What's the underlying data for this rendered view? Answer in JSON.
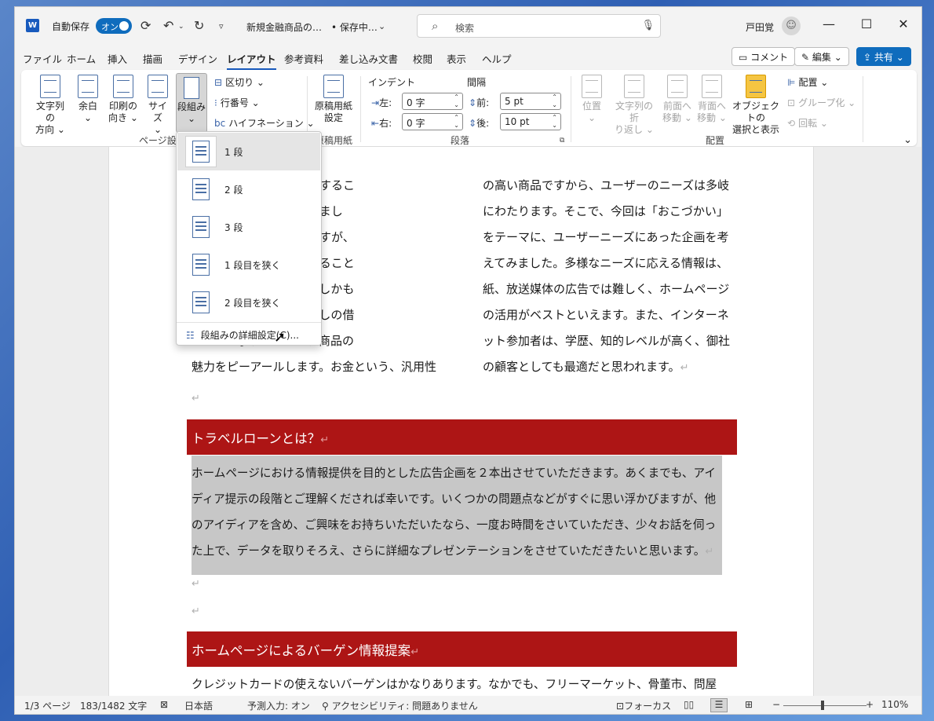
{
  "app": {
    "autosave_label": "自動保存",
    "autosave_state": "オン",
    "doc_title": "新規金融商品の…",
    "doc_status": "• 保存中…",
    "search_placeholder": "検索",
    "user_name": "戸田覚"
  },
  "tabs": [
    "ファイル",
    "ホーム",
    "挿入",
    "描画",
    "デザイン",
    "レイアウト",
    "参考資料",
    "差し込み文書",
    "校閲",
    "表示",
    "ヘルプ"
  ],
  "active_tab": "レイアウト",
  "top_buttons": {
    "comment": "コメント",
    "edit": "編集",
    "share": "共有"
  },
  "ribbon": {
    "page_setup": {
      "group_label": "ページ設定",
      "text_direction": [
        "文字列の",
        "方向"
      ],
      "margins": "余白",
      "orientation": [
        "印刷の",
        "向き"
      ],
      "size": "サイズ",
      "columns": "段組み",
      "breaks": "区切り",
      "line_numbers": "行番号",
      "hyphenation": "ハイフネーション"
    },
    "manuscript": {
      "group_label": "原稿用紙",
      "button": [
        "原稿用紙",
        "設定"
      ]
    },
    "paragraph": {
      "group_label": "段落",
      "indent_label": "インデント",
      "spacing_label": "間隔",
      "left_label": "左:",
      "right_label": "右:",
      "before_label": "前:",
      "after_label": "後:",
      "left_value": "0 字",
      "right_value": "0 字",
      "before_value": "5 pt",
      "after_value": "10 pt"
    },
    "arrange": {
      "group_label": "配置",
      "position": "位置",
      "wrap_text": [
        "文字列の折",
        "り返し"
      ],
      "bring_forward": [
        "前面へ",
        "移動"
      ],
      "send_backward": [
        "背面へ",
        "移動"
      ],
      "selection_pane": [
        "オブジェクトの",
        "選択と表示"
      ],
      "align": "配置",
      "group": "グループ化",
      "rotate": "回転"
    }
  },
  "columns_menu": {
    "items": [
      "1 段",
      "2 段",
      "3 段",
      "1 段目を狭く",
      "2 段目を狭く"
    ],
    "more": "段組みの詳細設定(C)..."
  },
  "document": {
    "left_column": [
      "「情報」を提供するこ",
      "ができると感じまし",
      "な商品がありますが、",
      "ーザーに明示すること",
      "ルにつながり、しかも",
      "つまり、金利なしの借",
      "示することで、商品の",
      "魅力をピーアールします。お金という、汎用性"
    ],
    "right_column": [
      "の高い商品ですから、ユーザーのニーズは多岐",
      "にわたります。そこで、今回は「おこづかい」",
      "をテーマに、ユーザーニーズにあった企画を考",
      "えてみました。多様なニーズに応える情報は、",
      "紙、放送媒体の広告では難しく、ホームページ",
      "の活用がベストといえます。また、インターネ",
      "ット参加者は、学歴、知的レベルが高く、御社",
      "の顧客としても最適だと思われます。"
    ],
    "heading1": "トラベルローンとは？",
    "body1": [
      "ホームページにおける情報提供を目的とした広告企画を２本出させていただきます。あくまでも、アイ",
      "ディア提示の段階とご理解くだされば幸いです。いくつかの問題点などがすぐに思い浮かびますが、他",
      "のアイディアを含め、ご興味をお持ちいただいたなら、一度お時間をさいていただき、少々お話を伺っ",
      "た上で、データを取りそろえ、さらに詳細なプレゼンテーションをさせていただきたいと思います。"
    ],
    "heading2": "ホームページによるバーゲン情報提案",
    "body2": "クレジットカードの使えないバーゲンはかなりあります。なかでも、フリーマーケット、骨董市、問屋",
    "para_mark": "↵"
  },
  "status": {
    "page": "1/3 ページ",
    "words": "183/1482 文字",
    "language": "日本語",
    "predict": "予測入力: オン",
    "accessibility": "アクセシビリティ: 問題ありません",
    "focus": "フォーカス",
    "zoom_percent": "110%",
    "zoom_level": 110
  },
  "colors": {
    "accent": "#0f6cbd",
    "heading": "#ad1515",
    "selection": "#c7c7c7"
  }
}
